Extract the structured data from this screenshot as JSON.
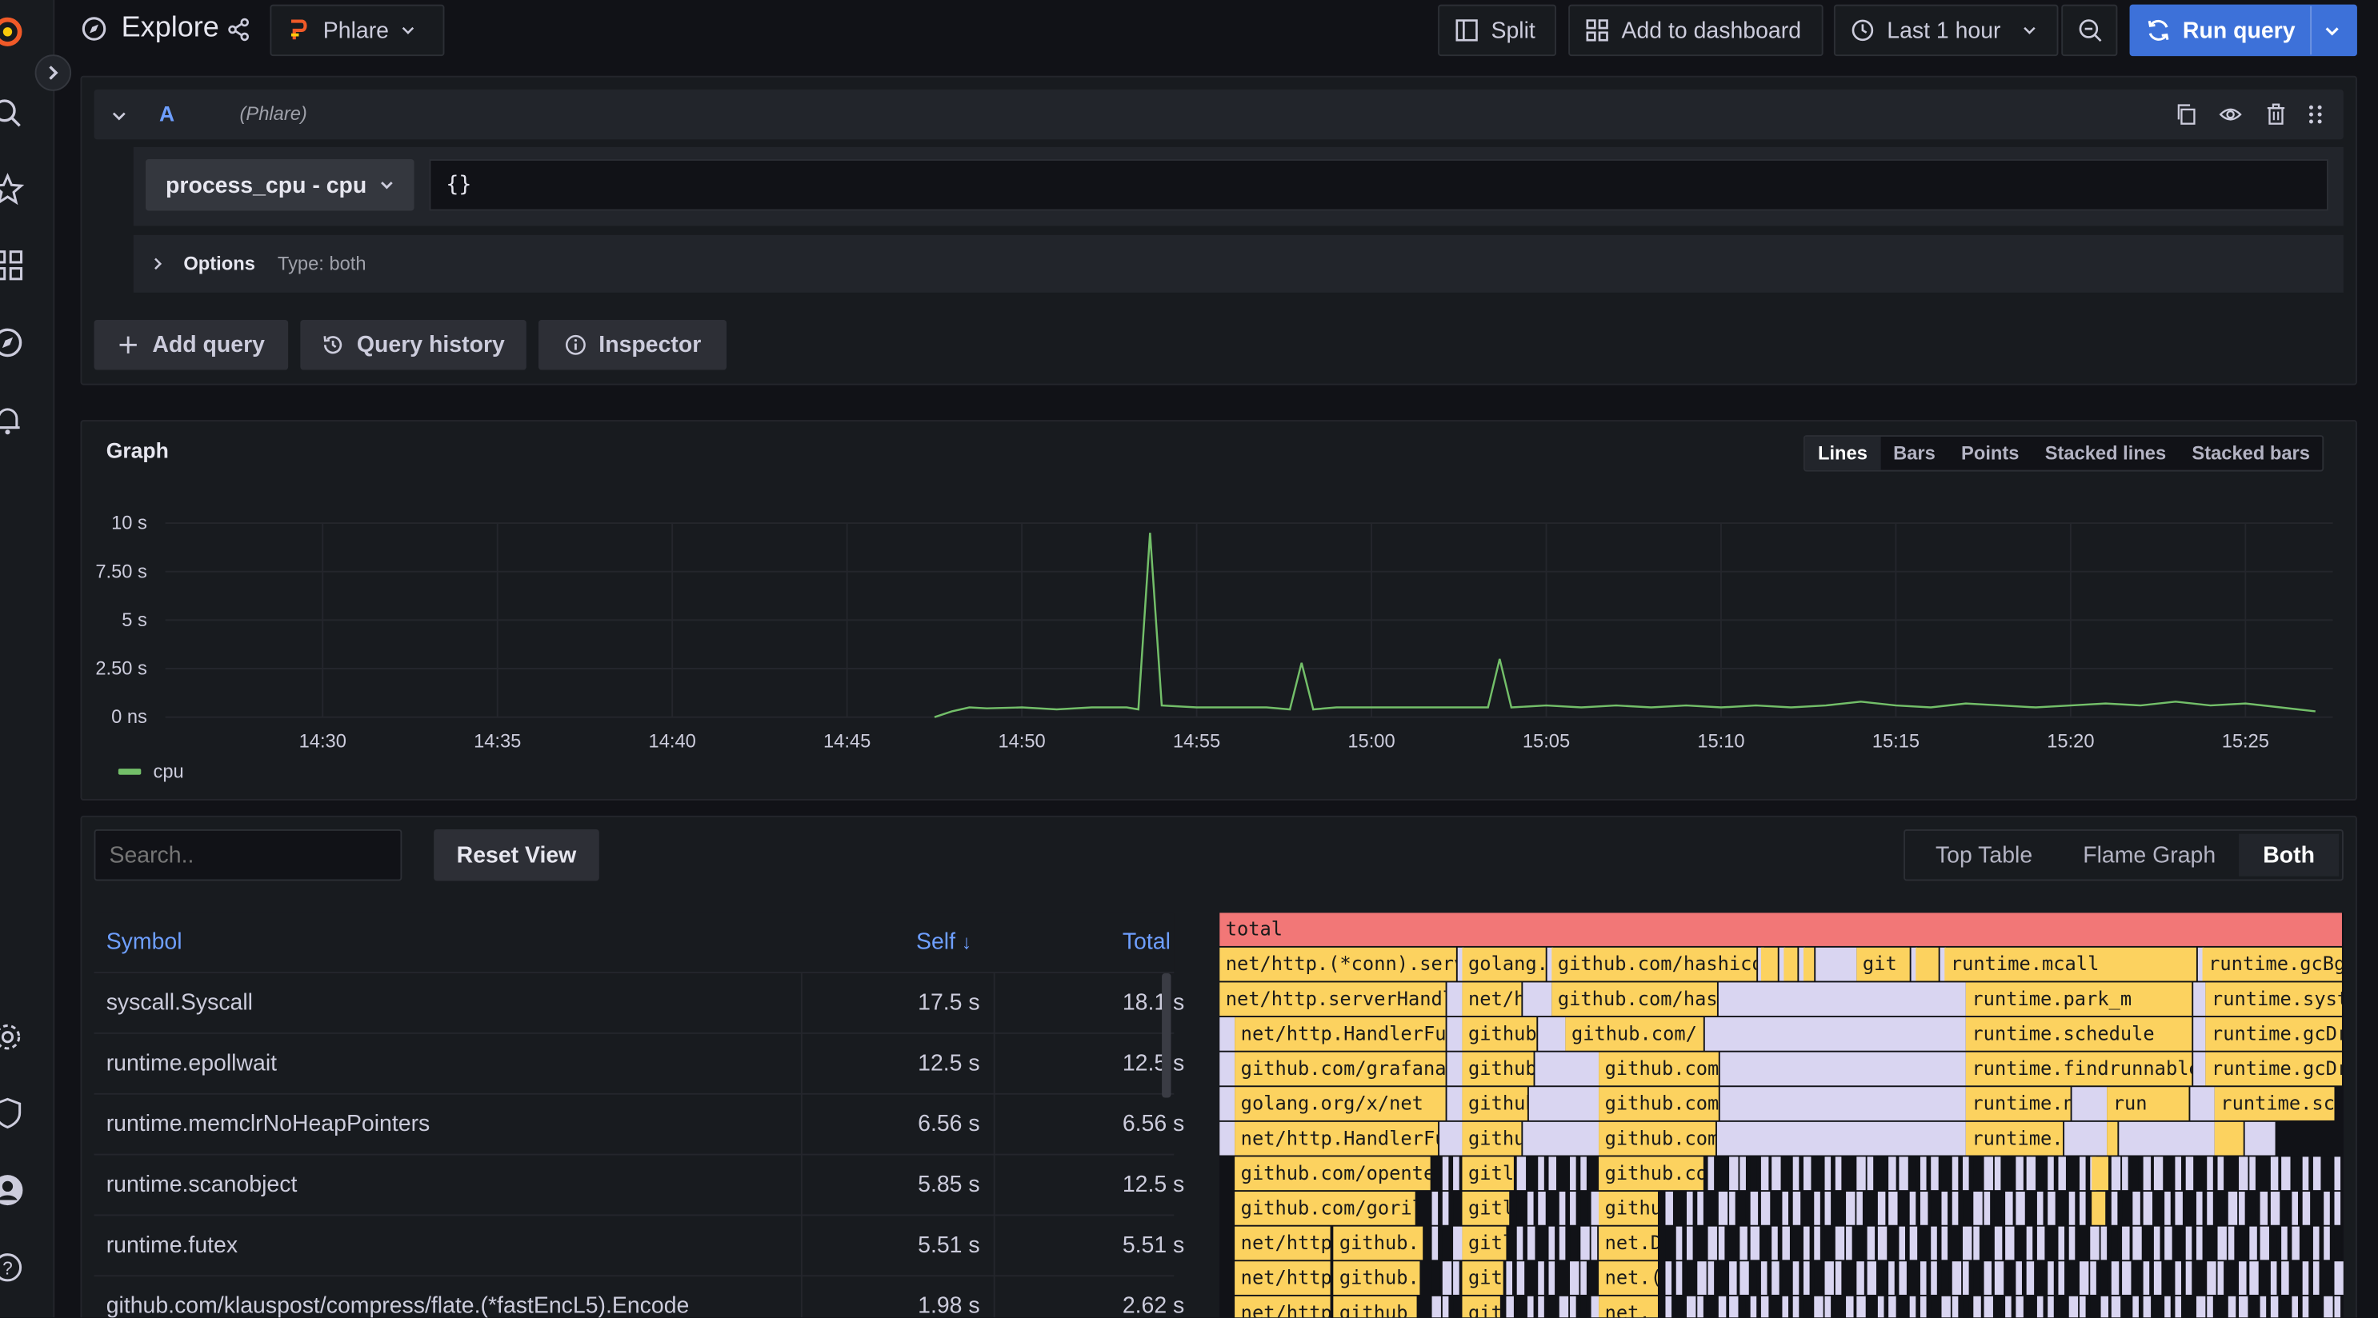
{
  "app": {
    "title": "Explore"
  },
  "datasource": {
    "name": "Phlare"
  },
  "toolbar": {
    "split": "Split",
    "add_to_dashboard": "Add to dashboard",
    "time_range": "Last 1 hour",
    "run_query": "Run query"
  },
  "query": {
    "ref_id": "A",
    "datasource_label": "(Phlare)",
    "profile_type": "process_cpu - cpu",
    "label_selector": "{}",
    "options_label": "Options",
    "options_type": "Type: both"
  },
  "query_actions": {
    "add_query": "Add query",
    "query_history": "Query history",
    "inspector": "Inspector"
  },
  "graph": {
    "title": "Graph",
    "view_modes": [
      "Lines",
      "Bars",
      "Points",
      "Stacked lines",
      "Stacked bars"
    ],
    "selected_mode": "Lines"
  },
  "chart_data": {
    "type": "line",
    "yticks": [
      "10 s",
      "7.50 s",
      "5 s",
      "2.50 s",
      "0 ns"
    ],
    "ylim": [
      0,
      10
    ],
    "xticks": [
      "14:30",
      "14:35",
      "14:40",
      "14:45",
      "14:50",
      "14:55",
      "15:00",
      "15:05",
      "15:10",
      "15:15",
      "15:20",
      "15:25"
    ],
    "series": [
      {
        "name": "cpu",
        "color": "#73bf69",
        "x": [
          "14:47:30",
          "14:48",
          "14:48:30",
          "14:49",
          "14:50",
          "14:51",
          "14:52",
          "14:53",
          "14:53:20",
          "14:53:40",
          "14:54",
          "14:55",
          "14:56",
          "14:57",
          "14:57:40",
          "14:58",
          "14:58:20",
          "14:59",
          "15:00",
          "15:01",
          "15:02",
          "15:03",
          "15:03:20",
          "15:03:40",
          "15:04",
          "15:05",
          "15:06",
          "15:07",
          "15:08",
          "15:09",
          "15:10",
          "15:11",
          "15:12",
          "15:13",
          "15:14",
          "15:15",
          "15:16",
          "15:17",
          "15:18",
          "15:19",
          "15:20",
          "15:21",
          "15:22",
          "15:23",
          "15:24",
          "15:25",
          "15:26",
          "15:27"
        ],
        "values": [
          0,
          0.3,
          0.5,
          0.45,
          0.5,
          0.4,
          0.5,
          0.5,
          0.4,
          9.5,
          0.6,
          0.5,
          0.5,
          0.5,
          0.4,
          2.8,
          0.4,
          0.5,
          0.5,
          0.5,
          0.5,
          0.5,
          0.5,
          3.0,
          0.5,
          0.6,
          0.5,
          0.6,
          0.5,
          0.6,
          0.5,
          0.6,
          0.5,
          0.6,
          0.8,
          0.6,
          0.5,
          0.7,
          0.6,
          0.5,
          0.6,
          0.7,
          0.6,
          0.8,
          0.6,
          0.7,
          0.5,
          0.3
        ]
      }
    ]
  },
  "profile": {
    "search_placeholder": "Search..",
    "reset_view": "Reset View",
    "views": [
      "Top Table",
      "Flame Graph",
      "Both"
    ],
    "selected_view": "Both"
  },
  "top_table": {
    "columns": [
      "Symbol",
      "Self",
      "Total"
    ],
    "rows": [
      {
        "symbol": "syscall.Syscall",
        "self": "17.5 s",
        "total": "18.1 s"
      },
      {
        "symbol": "runtime.epollwait",
        "self": "12.5 s",
        "total": "12.5 s"
      },
      {
        "symbol": "runtime.memclrNoHeapPointers",
        "self": "6.56 s",
        "total": "6.56 s"
      },
      {
        "symbol": "runtime.scanobject",
        "self": "5.85 s",
        "total": "12.5 s"
      },
      {
        "symbol": "runtime.futex",
        "self": "5.51 s",
        "total": "5.51 s"
      },
      {
        "symbol": "github.com/klauspost/compress/flate.(*fastEncL5).Encode",
        "self": "1.98 s",
        "total": "2.62 s"
      }
    ]
  },
  "flame": {
    "colors": {
      "root": "#f27777",
      "yellow": "#fcd25f",
      "lavender": "#d9d5f1",
      "dark": "#111217"
    },
    "labels": {
      "total": "total",
      "c1": "net/http.(*conn).serve",
      "c2": "golang.org",
      "c3": "github.com/hashicorp",
      "c4": "git",
      "c5": "runtime.mcall",
      "c6": "runtime.gcBgMarkWorker",
      "d1": "net/http.serverHandler",
      "d2": "net/http",
      "d3": "github.com/hashicorp",
      "d4": "runtime.park_m",
      "d5": "runtime.systemstack",
      "e1": "net/http.HandlerFunc",
      "e2": "github.com",
      "e3": "github.com/",
      "e4": "runtime.schedule",
      "e5": "runtime.gcDrain",
      "f1": "github.com/grafana",
      "f2": "github",
      "f3": "github.com",
      "f4": "runtime.findrunnable",
      "f5": "runtime.gcDrain",
      "g1": "golang.org/x/net",
      "g2": "github",
      "g3": "github.com",
      "g4": "runtime.netpoll",
      "g5": "run",
      "g6": "runtime.scanobject",
      "h1": "net/http.HandlerFunc",
      "h2": "github",
      "h3": "github.com",
      "h4": "runtime.epollwait",
      "i1": "github.com/opentelemetry",
      "i2": "gitl",
      "i3": "github.com",
      "j1": "github.com/gorilla",
      "j2": "gitl",
      "j3": "github",
      "k1": "net/http",
      "k2": "github.",
      "k3": "gitl",
      "k4": "net.D",
      "l1": "net/http",
      "l2": "github.",
      "l3": "gitl",
      "l4": "net.(",
      "m1": "net/http",
      "m2": "github",
      "m3": "gitl",
      "m4": "net."
    }
  }
}
